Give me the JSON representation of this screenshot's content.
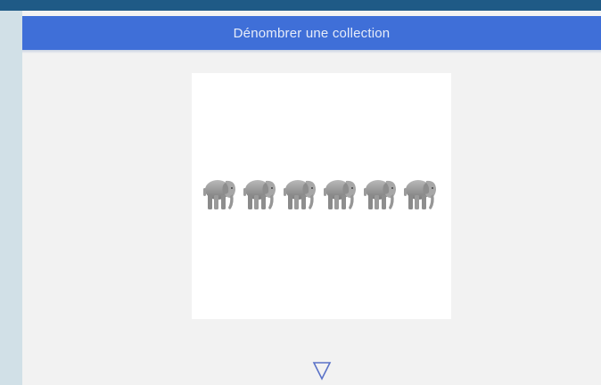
{
  "header": {
    "title": "Dénombrer une collection"
  },
  "card": {
    "items": [
      {
        "icon": "elephant-icon"
      },
      {
        "icon": "elephant-icon"
      },
      {
        "icon": "elephant-icon"
      },
      {
        "icon": "elephant-icon"
      },
      {
        "icon": "elephant-icon"
      },
      {
        "icon": "elephant-icon"
      }
    ]
  },
  "navigation": {
    "next_icon": "triangle-down-icon"
  },
  "colors": {
    "top_strip": "#1f5a86",
    "left_strip": "#d1e0e7",
    "header": "#3f6fd8",
    "background": "#f2f2f2",
    "card": "#ffffff",
    "arrow": "#5a72c8"
  }
}
